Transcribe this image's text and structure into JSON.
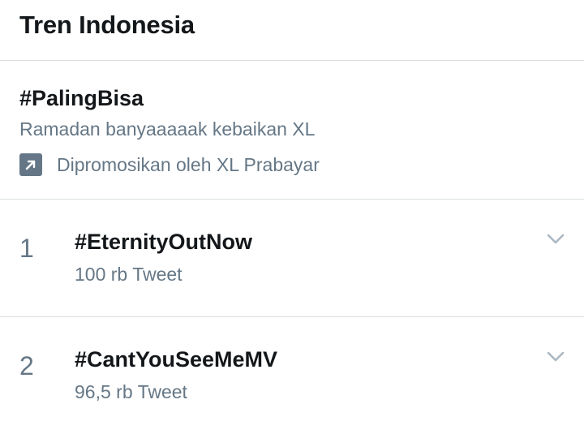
{
  "header": {
    "title": "Tren Indonesia"
  },
  "promoted": {
    "hashtag": "#PalingBisa",
    "description": "Ramadan banyaaaaak kebaikan XL",
    "promoted_by": "Dipromosikan oleh XL Prabayar",
    "icon": "promoted-arrow-icon"
  },
  "trends": [
    {
      "rank": "1",
      "name": "#EternityOutNow",
      "count": "100 rb Tweet",
      "icon": "chevron-down-icon"
    },
    {
      "rank": "2",
      "name": "#CantYouSeeMeMV",
      "count": "96,5 rb Tweet",
      "icon": "chevron-down-icon"
    }
  ],
  "colors": {
    "text_primary": "#14171a",
    "text_secondary": "#657786",
    "divider": "#d8dde1",
    "chevron": "#aab8c2"
  }
}
